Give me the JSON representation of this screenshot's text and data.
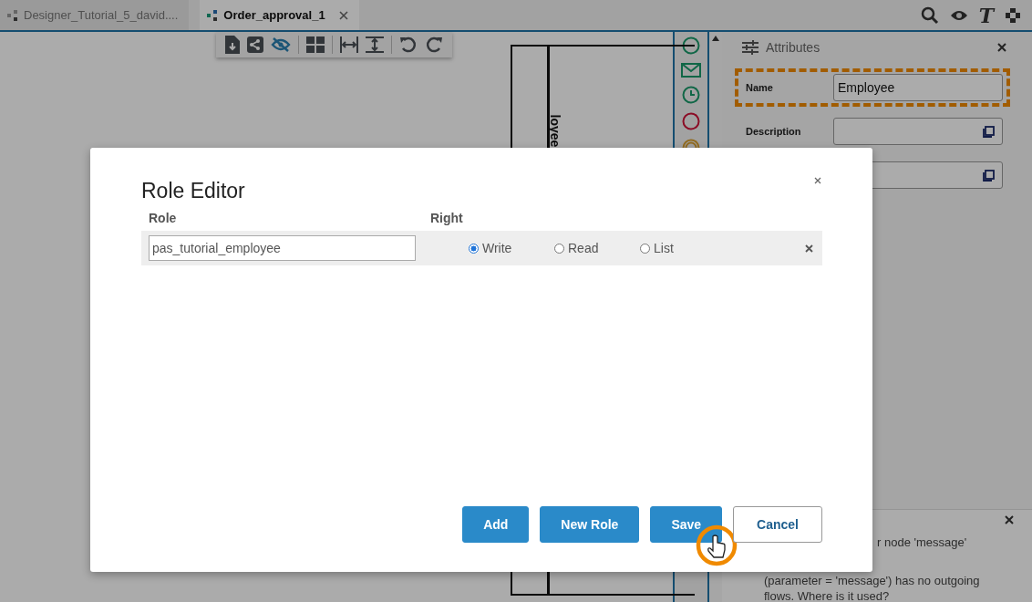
{
  "tabs": [
    {
      "label": "Designer_Tutorial_5_david....",
      "selected": false
    },
    {
      "label": "Order_approval_1",
      "selected": true
    }
  ],
  "header_tools": {
    "format_glyph": "T"
  },
  "canvas": {
    "lane_label": "loyee"
  },
  "attributes": {
    "title": "Attributes",
    "rows": [
      {
        "label": "Name",
        "value": "Employee",
        "has_popout": false,
        "highlighted": true
      },
      {
        "label": "Description",
        "value": "",
        "has_popout": true,
        "highlighted": false
      },
      {
        "label": "",
        "value": "",
        "has_popout": true,
        "highlighted": false
      }
    ]
  },
  "message_panel": {
    "lines": [
      "r node 'message'",
      "(parameter = 'message') has no outgoing",
      "flows. Where is it used?"
    ]
  },
  "dialog": {
    "title": "Role Editor",
    "columns": [
      "Role",
      "Right"
    ],
    "rows": [
      {
        "role": "pas_tutorial_employee",
        "rights": [
          {
            "label": "Write",
            "selected": true
          },
          {
            "label": "Read",
            "selected": false
          },
          {
            "label": "List",
            "selected": false
          }
        ]
      }
    ],
    "buttons": [
      {
        "label": "Add",
        "kind": "primary",
        "pointer": false
      },
      {
        "label": "New Role",
        "kind": "primary",
        "pointer": false
      },
      {
        "label": "Save",
        "kind": "primary",
        "pointer": true
      },
      {
        "label": "Cancel",
        "kind": "secondary",
        "pointer": false
      }
    ]
  }
}
